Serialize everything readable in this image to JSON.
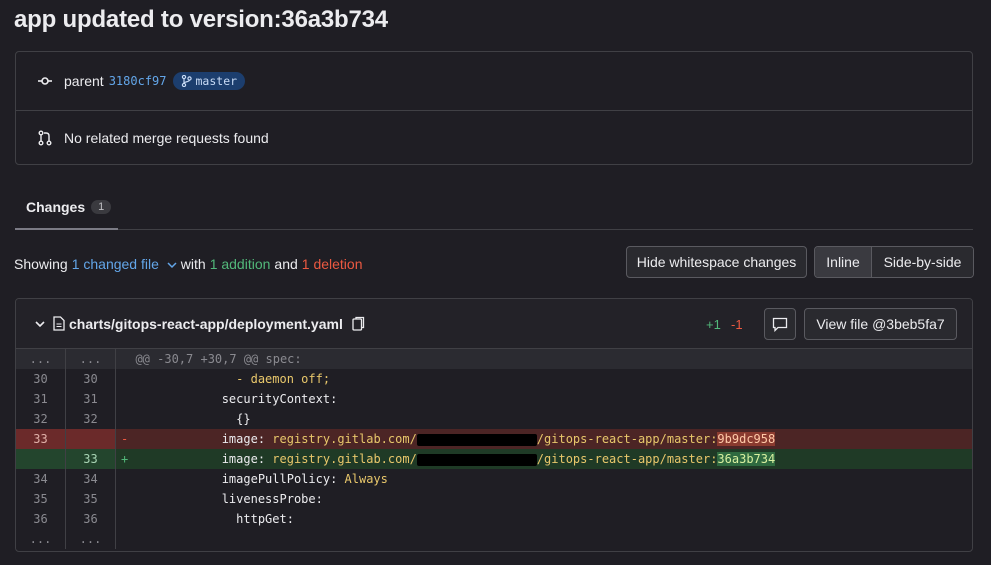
{
  "title": "app updated to version:36a3b734",
  "info": {
    "parent_label": "parent",
    "parent_sha": "3180cf97",
    "branch": "master",
    "merge_requests": "No related merge requests found"
  },
  "tabs": {
    "changes_label": "Changes",
    "changes_count": "1"
  },
  "summary": {
    "showing": "Showing",
    "changed_file": "1 changed file",
    "with": "with",
    "addition": "1 addition",
    "and": "and",
    "deletion": "1 deletion"
  },
  "buttons": {
    "hide_whitespace": "Hide whitespace changes",
    "inline": "Inline",
    "side_by_side": "Side-by-side"
  },
  "file": {
    "path": "charts/gitops-react-app/deployment.yaml",
    "additions": "+1",
    "deletions": "-1",
    "view_file": "View file @3beb5fa7"
  },
  "diff": {
    "hunk_old": "...",
    "hunk_new": "...",
    "hunk_header": "@@ -30,7 +30,7 @@ spec:",
    "lines": [
      {
        "old": "30",
        "new": "30",
        "indent": "              ",
        "text": "- daemon off;"
      },
      {
        "old": "31",
        "new": "31",
        "indent": "            ",
        "text": "securityContext:"
      },
      {
        "old": "32",
        "new": "32",
        "indent": "              ",
        "text": "{}"
      }
    ],
    "del": {
      "old": "33",
      "sign": "-",
      "indent": "            ",
      "key": "image:",
      "prefix": "registry.gitlab.com/",
      "middle": "/gitops-react-app/master:",
      "tag": "9b9dc958"
    },
    "add": {
      "new": "33",
      "sign": "+",
      "indent": "            ",
      "key": "image:",
      "prefix": "registry.gitlab.com/",
      "middle": "/gitops-react-app/master:",
      "tag": "36a3b734"
    },
    "after": [
      {
        "old": "34",
        "new": "34",
        "indent": "            ",
        "key": "imagePullPolicy:",
        "value": "Always"
      },
      {
        "old": "35",
        "new": "35",
        "indent": "            ",
        "key": "livenessProbe:",
        "value": ""
      },
      {
        "old": "36",
        "new": "36",
        "indent": "              ",
        "key": "httpGet:",
        "value": ""
      }
    ],
    "tail_old": "...",
    "tail_new": "..."
  }
}
